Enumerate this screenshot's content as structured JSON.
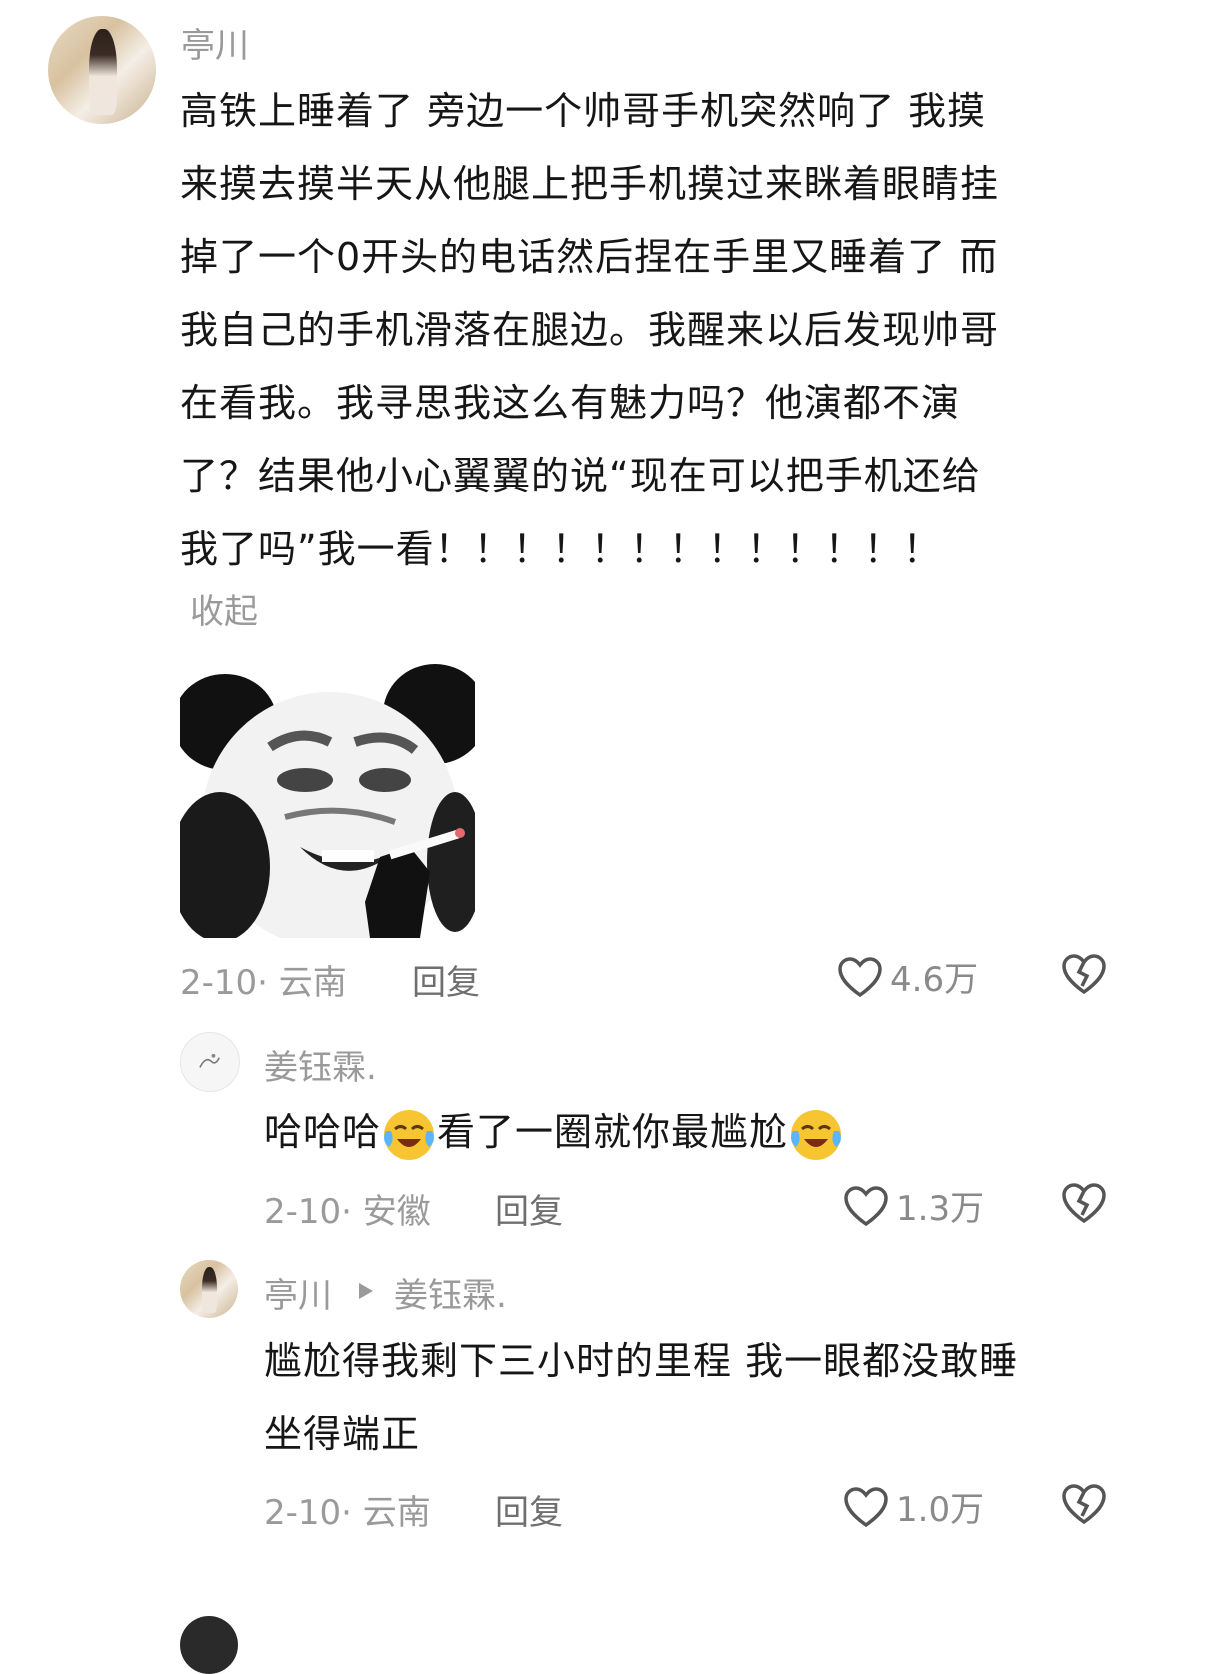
{
  "comments": [
    {
      "username": "亭川",
      "lines": [
        "高铁上睡着了 旁边一个帅哥手机突然响了 我摸",
        "来摸去摸半天从他腿上把手机摸过来眯着眼睛挂",
        "掉了一个0开头的电话然后捏在手里又睡着了 而",
        "我自己的手机滑落在腿边。我醒来以后发现帅哥",
        "在看我。我寻思我这么有魅力吗？他演都不演",
        "了？结果他小心翼翼的说“现在可以把手机还给",
        "我了吗”我一看！！！！！！！！！！！！！"
      ],
      "collapse_label": "收起",
      "date_location": "2-10· 云南",
      "reply_label": "回复",
      "likes": "4.6万"
    },
    {
      "username": "姜钰霖.",
      "text_a": "哈哈哈",
      "text_b": "看了一圈就你最尴尬",
      "emoji_name": "crying-laughing-emoji",
      "date_location": "2-10· 安徽",
      "reply_label": "回复",
      "likes": "1.3万"
    },
    {
      "username": "亭川",
      "reply_to": "姜钰霖.",
      "lines": [
        "尴尬得我剩下三小时的里程 我一眼都没敢睡",
        "坐得端正"
      ],
      "date_location": "2-10· 云南",
      "reply_label": "回复",
      "likes": "1.0万"
    }
  ],
  "icons": {
    "like": "heart-outline-icon",
    "dislike": "broken-heart-icon",
    "reply_arrow": "triangle-right-icon"
  },
  "colors": {
    "secondary_text": "#9a9a9a",
    "primary_text": "#161616"
  }
}
